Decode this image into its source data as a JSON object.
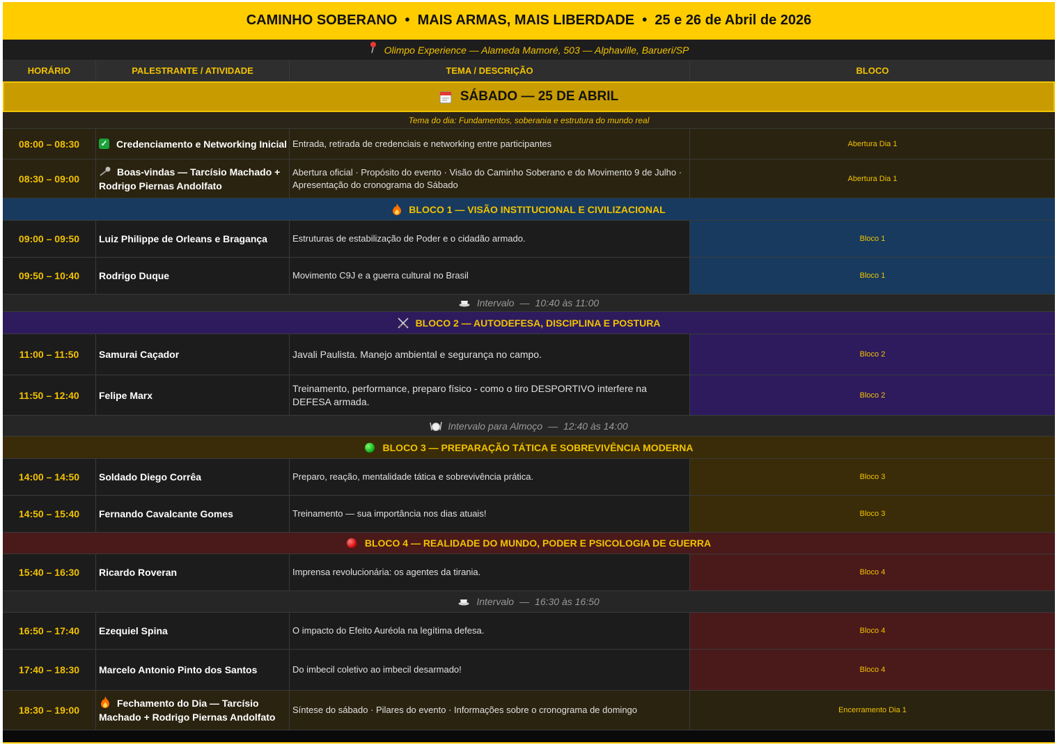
{
  "header": {
    "title": "CAMINHO SOBERANO  •  MAIS ARMAS, MAIS LIBERDADE  •  25 e 26 de Abril de 2026",
    "venue": "Olimpo Experience — Alameda Mamoré, 503 — Alphaville, Barueri/SP",
    "venue_icon": "pin-icon"
  },
  "columns": [
    "HORÁRIO",
    "PALESTRANTE / ATIVIDADE",
    "TEMA / DESCRIÇÃO",
    "BLOCO"
  ],
  "day": {
    "label": "SÁBADO — 25 DE ABRIL",
    "icon": "calendar-icon",
    "theme": "Tema do dia: Fundamentos, soberania e estrutura do mundo real"
  },
  "colors": {
    "accent": "#ffcc00",
    "opening_bg": "#2a2310",
    "bloco1_bg": "#173a5e",
    "bloco2_bg": "#2d1b5e",
    "bloco3_bg": "#3a2c08",
    "bloco4_bg": "#4a1a1a"
  },
  "opening": [
    {
      "time": "08:00 – 08:30",
      "speaker": "Credenciamento e Networking Inicial",
      "icon": "check-icon",
      "desc": "Entrada, retirada de credenciais e networking entre participantes",
      "block": "Abertura Dia 1"
    },
    {
      "time": "08:30 – 09:00",
      "speaker": "Boas-vindas — Tarcísio Machado + Rodrigo Piernas Andolfato",
      "icon": "microphone-icon",
      "desc": "Abertura oficial · Propósito do evento · Visão do Caminho Soberano e do Movimento 9 de Julho · Apresentação do cronograma do Sábado",
      "block": "Abertura Dia 1"
    }
  ],
  "bloco1": {
    "title": "BLOCO 1 — VISÃO INSTITUCIONAL E CIVILIZACIONAL",
    "icon": "fire-icon",
    "rows": [
      {
        "time": "09:00 – 09:50",
        "speaker": "Luiz Philippe de Orleans e Bragança",
        "desc": "Estruturas de estabilização de Poder e o cidadão armado.",
        "block": "Bloco 1"
      },
      {
        "time": "09:50 – 10:40",
        "speaker": "Rodrigo Duque",
        "desc": "Movimento C9J e a guerra cultural no Brasil",
        "block": "Bloco 1"
      }
    ]
  },
  "break1": {
    "label": "Intervalo",
    "time": "10:40 às 11:00",
    "icon": "coffee-icon"
  },
  "bloco2": {
    "title": "BLOCO 2 — AUTODEFESA, DISCIPLINA E POSTURA",
    "icon": "crossed-swords-icon",
    "rows": [
      {
        "time": "11:00 – 11:50",
        "speaker": "Samurai Caçador",
        "desc": "Javali Paulista. Manejo ambiental e segurança no campo.",
        "block": "Bloco 2"
      },
      {
        "time": "11:50 – 12:40",
        "speaker": "Felipe Marx",
        "desc": "Treinamento, performance, preparo físico - como o tiro DESPORTIVO interfere na DEFESA armada.",
        "block": "Bloco 2"
      }
    ]
  },
  "break2": {
    "label": "Intervalo para Almoço",
    "time": "12:40 às 14:00",
    "icon": "plate-icon"
  },
  "bloco3": {
    "title": "BLOCO 3 — PREPARAÇÃO TÁTICA E SOBREVIVÊNCIA MODERNA",
    "icon": "green-circle-icon",
    "rows": [
      {
        "time": "14:00 – 14:50",
        "speaker": "Soldado Diego Corrêa",
        "desc": "Preparo, reação, mentalidade tática e sobrevivência prática.",
        "block": "Bloco 3"
      },
      {
        "time": "14:50 – 15:40",
        "speaker": "Fernando Cavalcante Gomes",
        "desc": "Treinamento — sua importância nos dias atuais!",
        "block": "Bloco 3"
      }
    ]
  },
  "bloco4": {
    "title": "BLOCO 4 — REALIDADE DO MUNDO, PODER E PSICOLOGIA DE GUERRA",
    "icon": "red-circle-icon",
    "rows": [
      {
        "time": "15:40 – 16:30",
        "speaker": "Ricardo Roveran",
        "desc": "Imprensa revolucionária: os agentes da tirania.",
        "block": "Bloco 4"
      },
      {
        "time": "16:50 – 17:40",
        "speaker": "Ezequiel Spina",
        "desc": "O impacto do Efeito Auréola na legítima defesa.",
        "block": "Bloco 4"
      },
      {
        "time": "17:40 – 18:30",
        "speaker": "Marcelo Antonio Pinto dos Santos",
        "desc": "Do imbecil coletivo ao imbecil desarmado!",
        "block": "Bloco 4"
      }
    ]
  },
  "break3": {
    "label": "Intervalo",
    "time": "16:30 às 16:50",
    "icon": "coffee-icon"
  },
  "closing": {
    "time": "18:30 – 19:00",
    "speaker": "Fechamento do Dia — Tarcísio Machado + Rodrigo Piernas Andolfato",
    "icon": "fire-icon",
    "desc": "Síntese do sábado · Pilares do evento · Informações sobre o cronograma de domingo",
    "block": "Encerramento Dia 1"
  }
}
